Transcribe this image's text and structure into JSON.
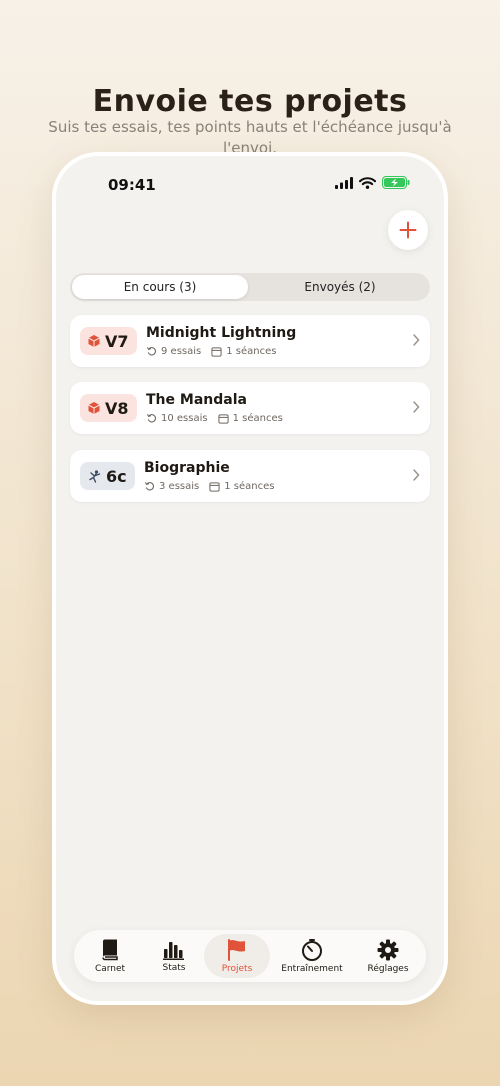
{
  "promo": {
    "headline": "Envoie tes projets",
    "subline": "Suis tes essais, tes points hauts et l'échéance jusqu'à l'envoi."
  },
  "status_bar": {
    "time": "09:41"
  },
  "segment": {
    "tabs": [
      {
        "label": "En cours (3)",
        "active": true
      },
      {
        "label": "Envoyés (2)",
        "active": false
      }
    ]
  },
  "projects": [
    {
      "grade": "V7",
      "grade_icon": "cube-icon",
      "grade_bg": "#fbe3df",
      "name": "Midnight Lightning",
      "attempts": "9 essais",
      "sessions": "1 séances"
    },
    {
      "grade": "V8",
      "grade_icon": "cube-icon",
      "grade_bg": "#fbe3df",
      "name": "The Mandala",
      "attempts": "10 essais",
      "sessions": "1 séances"
    },
    {
      "grade": "6c",
      "grade_icon": "climber-icon",
      "grade_bg": "#e5e9ee",
      "name": "Biographie",
      "attempts": "3 essais",
      "sessions": "1 séances"
    }
  ],
  "tabbar": {
    "items": [
      {
        "label": "Carnet",
        "icon": "book-icon",
        "active": false
      },
      {
        "label": "Stats",
        "icon": "bar-chart-icon",
        "active": false
      },
      {
        "label": "Projets",
        "icon": "flag-icon",
        "active": true
      },
      {
        "label": "Entraînement",
        "icon": "timer-icon",
        "active": false
      },
      {
        "label": "Réglages",
        "icon": "gear-icon",
        "active": false
      }
    ]
  },
  "colors": {
    "accent": "#e0533a",
    "background": "#f4f2ef",
    "card": "#ffffff"
  }
}
